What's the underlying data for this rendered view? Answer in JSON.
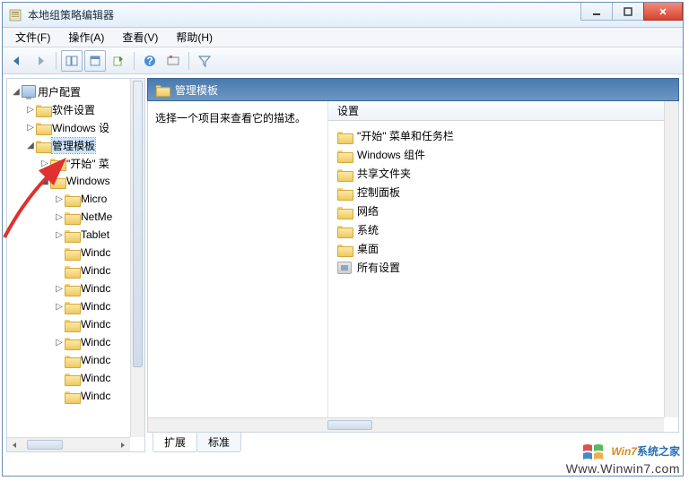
{
  "window": {
    "title": "本地组策略编辑器"
  },
  "menu": {
    "file": "文件(F)",
    "action": "操作(A)",
    "view": "查看(V)",
    "help": "帮助(H)"
  },
  "tree": {
    "root": "用户配置",
    "software": "软件设置",
    "windows_settings": "Windows 设",
    "admin_templates": "管理模板",
    "start_menu": "\"开始\" 菜",
    "windows_comp": "Windows",
    "micro": "Micro",
    "netme": "NetMe",
    "tablet": "Tablet",
    "w1": "Windc",
    "w2": "Windc",
    "w3": "Windc",
    "w4": "Windc",
    "w5": "Windc",
    "w6": "Windc",
    "w7": "Windc",
    "w8": "Windc",
    "w9": "Windc"
  },
  "right": {
    "header": "管理模板",
    "description": "选择一个项目来查看它的描述。",
    "list_header": "设置",
    "items": {
      "0": "\"开始\" 菜单和任务栏",
      "1": "Windows 组件",
      "2": "共享文件夹",
      "3": "控制面板",
      "4": "网络",
      "5": "系统",
      "6": "桌面",
      "7": "所有设置"
    }
  },
  "tabs": {
    "extended": "扩展",
    "standard": "标准"
  },
  "watermark": {
    "brand_en": "Win7",
    "brand_cn": "系统之家",
    "url": "Www.Winwin7.com"
  }
}
